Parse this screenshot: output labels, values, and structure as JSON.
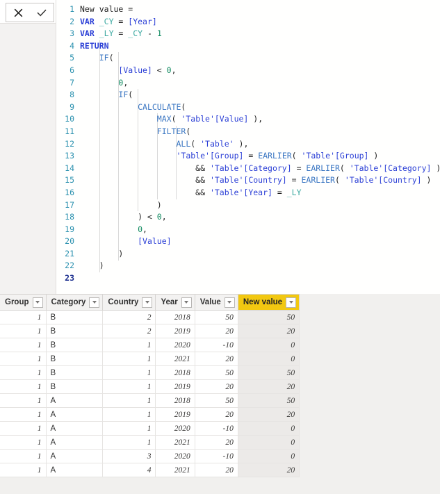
{
  "formula_bar": {
    "cancel_label": "✕",
    "accept_label": "✓",
    "lines": [
      {
        "n": "1",
        "tokens": [
          {
            "c": "t-plain",
            "t": "New value ="
          }
        ]
      },
      {
        "n": "2",
        "tokens": [
          {
            "c": "t-kw",
            "t": "VAR"
          },
          {
            "c": "t-plain",
            "t": " "
          },
          {
            "c": "t-var",
            "t": "_CY"
          },
          {
            "c": "t-plain",
            "t": " = "
          },
          {
            "c": "t-col",
            "t": "[Year]"
          }
        ]
      },
      {
        "n": "3",
        "tokens": [
          {
            "c": "t-kw",
            "t": "VAR"
          },
          {
            "c": "t-plain",
            "t": " "
          },
          {
            "c": "t-var",
            "t": "_LY"
          },
          {
            "c": "t-plain",
            "t": " = "
          },
          {
            "c": "t-var",
            "t": "_CY"
          },
          {
            "c": "t-plain",
            "t": " - "
          },
          {
            "c": "t-num",
            "t": "1"
          }
        ]
      },
      {
        "n": "4",
        "tokens": [
          {
            "c": "t-kw",
            "t": "RETURN"
          }
        ]
      },
      {
        "n": "5",
        "tokens": [
          {
            "c": "t-plain",
            "t": "    "
          },
          {
            "c": "t-func",
            "t": "IF"
          },
          {
            "c": "t-plain",
            "t": "("
          }
        ]
      },
      {
        "n": "6",
        "tokens": [
          {
            "c": "t-plain",
            "t": "        "
          },
          {
            "c": "t-col",
            "t": "[Value]"
          },
          {
            "c": "t-plain",
            "t": " < "
          },
          {
            "c": "t-num",
            "t": "0"
          },
          {
            "c": "t-plain",
            "t": ","
          }
        ]
      },
      {
        "n": "7",
        "tokens": [
          {
            "c": "t-plain",
            "t": "        "
          },
          {
            "c": "t-num",
            "t": "0"
          },
          {
            "c": "t-plain",
            "t": ","
          }
        ]
      },
      {
        "n": "8",
        "tokens": [
          {
            "c": "t-plain",
            "t": "        "
          },
          {
            "c": "t-func",
            "t": "IF"
          },
          {
            "c": "t-plain",
            "t": "("
          }
        ]
      },
      {
        "n": "9",
        "tokens": [
          {
            "c": "t-plain",
            "t": "            "
          },
          {
            "c": "t-func",
            "t": "CALCULATE"
          },
          {
            "c": "t-plain",
            "t": "("
          }
        ]
      },
      {
        "n": "10",
        "tokens": [
          {
            "c": "t-plain",
            "t": "                "
          },
          {
            "c": "t-func",
            "t": "MAX"
          },
          {
            "c": "t-plain",
            "t": "( "
          },
          {
            "c": "t-tbl",
            "t": "'Table'[Value]"
          },
          {
            "c": "t-plain",
            "t": " ),"
          }
        ]
      },
      {
        "n": "11",
        "tokens": [
          {
            "c": "t-plain",
            "t": "                "
          },
          {
            "c": "t-func",
            "t": "FILTER"
          },
          {
            "c": "t-plain",
            "t": "("
          }
        ]
      },
      {
        "n": "12",
        "tokens": [
          {
            "c": "t-plain",
            "t": "                    "
          },
          {
            "c": "t-func",
            "t": "ALL"
          },
          {
            "c": "t-plain",
            "t": "( "
          },
          {
            "c": "t-tbl",
            "t": "'Table'"
          },
          {
            "c": "t-plain",
            "t": " ),"
          }
        ]
      },
      {
        "n": "13",
        "tokens": [
          {
            "c": "t-plain",
            "t": "                    "
          },
          {
            "c": "t-tbl",
            "t": "'Table'[Group]"
          },
          {
            "c": "t-plain",
            "t": " = "
          },
          {
            "c": "t-func",
            "t": "EARLIER"
          },
          {
            "c": "t-plain",
            "t": "( "
          },
          {
            "c": "t-tbl",
            "t": "'Table'[Group]"
          },
          {
            "c": "t-plain",
            "t": " )"
          }
        ]
      },
      {
        "n": "14",
        "tokens": [
          {
            "c": "t-plain",
            "t": "                        && "
          },
          {
            "c": "t-tbl",
            "t": "'Table'[Category]"
          },
          {
            "c": "t-plain",
            "t": " = "
          },
          {
            "c": "t-func",
            "t": "EARLIER"
          },
          {
            "c": "t-plain",
            "t": "( "
          },
          {
            "c": "t-tbl",
            "t": "'Table'[Category]"
          },
          {
            "c": "t-plain",
            "t": " )"
          }
        ]
      },
      {
        "n": "15",
        "tokens": [
          {
            "c": "t-plain",
            "t": "                        && "
          },
          {
            "c": "t-tbl",
            "t": "'Table'[Country]"
          },
          {
            "c": "t-plain",
            "t": " = "
          },
          {
            "c": "t-func",
            "t": "EARLIER"
          },
          {
            "c": "t-plain",
            "t": "( "
          },
          {
            "c": "t-tbl",
            "t": "'Table'[Country]"
          },
          {
            "c": "t-plain",
            "t": " )"
          }
        ]
      },
      {
        "n": "16",
        "tokens": [
          {
            "c": "t-plain",
            "t": "                        && "
          },
          {
            "c": "t-tbl",
            "t": "'Table'[Year]"
          },
          {
            "c": "t-plain",
            "t": " = "
          },
          {
            "c": "t-var",
            "t": "_LY"
          }
        ]
      },
      {
        "n": "17",
        "tokens": [
          {
            "c": "t-plain",
            "t": "                )"
          }
        ]
      },
      {
        "n": "18",
        "tokens": [
          {
            "c": "t-plain",
            "t": "            ) < "
          },
          {
            "c": "t-num",
            "t": "0"
          },
          {
            "c": "t-plain",
            "t": ","
          }
        ]
      },
      {
        "n": "19",
        "tokens": [
          {
            "c": "t-plain",
            "t": "            "
          },
          {
            "c": "t-num",
            "t": "0"
          },
          {
            "c": "t-plain",
            "t": ","
          }
        ]
      },
      {
        "n": "20",
        "tokens": [
          {
            "c": "t-plain",
            "t": "            "
          },
          {
            "c": "t-col",
            "t": "[Value]"
          }
        ]
      },
      {
        "n": "21",
        "tokens": [
          {
            "c": "t-plain",
            "t": "        )"
          }
        ]
      },
      {
        "n": "22",
        "tokens": [
          {
            "c": "t-plain",
            "t": "    )"
          }
        ]
      },
      {
        "n": "23",
        "tokens": []
      }
    ],
    "current_line": "23"
  },
  "grid": {
    "columns": [
      {
        "label": "Group",
        "width": 60,
        "align": "num",
        "highlight": false
      },
      {
        "label": "Category",
        "width": 80,
        "align": "txt",
        "highlight": false
      },
      {
        "label": "Country",
        "width": 74,
        "align": "num",
        "highlight": false
      },
      {
        "label": "Year",
        "width": 52,
        "align": "num",
        "highlight": false
      },
      {
        "label": "Value",
        "width": 58,
        "align": "num",
        "highlight": false
      },
      {
        "label": "New value",
        "width": 82,
        "align": "num",
        "highlight": true
      }
    ],
    "rows": [
      [
        "1",
        "B",
        "2",
        "2018",
        "50",
        "50"
      ],
      [
        "1",
        "B",
        "2",
        "2019",
        "20",
        "20"
      ],
      [
        "1",
        "B",
        "1",
        "2020",
        "-10",
        "0"
      ],
      [
        "1",
        "B",
        "1",
        "2021",
        "20",
        "0"
      ],
      [
        "1",
        "B",
        "1",
        "2018",
        "50",
        "50"
      ],
      [
        "1",
        "B",
        "1",
        "2019",
        "20",
        "20"
      ],
      [
        "1",
        "A",
        "1",
        "2018",
        "50",
        "50"
      ],
      [
        "1",
        "A",
        "1",
        "2019",
        "20",
        "20"
      ],
      [
        "1",
        "A",
        "1",
        "2020",
        "-10",
        "0"
      ],
      [
        "1",
        "A",
        "1",
        "2021",
        "20",
        "0"
      ],
      [
        "1",
        "A",
        "3",
        "2020",
        "-10",
        "0"
      ],
      [
        "1",
        "A",
        "4",
        "2021",
        "20",
        "20"
      ]
    ],
    "filter_icon": "chevron-down-icon",
    "highlight_color": "#f2c811"
  }
}
